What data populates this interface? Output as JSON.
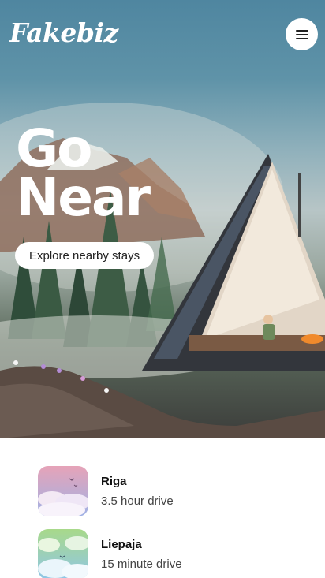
{
  "header": {
    "logo_text": "Fakebiz",
    "menu_icon": "hamburger-menu-icon"
  },
  "hero": {
    "headline_line1": "Go",
    "headline_line2": "Near",
    "cta_label": "Explore nearby stays",
    "image": "a-frame-cabin-forest-illustration"
  },
  "destinations": [
    {
      "name": "Riga",
      "distance": "3.5 hour drive",
      "thumb": "pink-clouds-birds-illustration"
    },
    {
      "name": "Liepaja",
      "distance": "15 minute drive",
      "thumb": "green-blue-clouds-birds-illustration"
    }
  ],
  "colors": {
    "sky": "#5f93a8",
    "cta_background": "#ffffff",
    "text_dark": "#111111"
  }
}
